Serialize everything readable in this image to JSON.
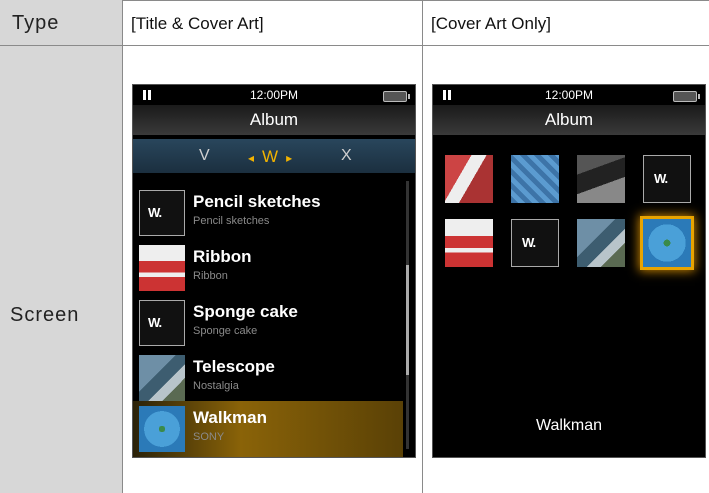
{
  "header": {
    "type_label": "Type",
    "col1": "[Title & Cover Art]",
    "col2": "[Cover Art Only]"
  },
  "row": {
    "label": "Screen"
  },
  "screen_title_cover": {
    "status": {
      "time": "12:00PM",
      "icons": [
        "pause-icon",
        "battery-icon"
      ]
    },
    "title": "Album",
    "letters": {
      "prev": "V",
      "current": "W",
      "next": "X"
    },
    "items": [
      {
        "title": "Pencil sketches",
        "subtitle": "Pencil sketches",
        "art": "walkman-logo"
      },
      {
        "title": "Ribbon",
        "subtitle": "Ribbon",
        "art": "ribbon-cover"
      },
      {
        "title": "Sponge cake",
        "subtitle": "Sponge cake",
        "art": "walkman-logo"
      },
      {
        "title": "Telescope",
        "subtitle": "Nostalgia",
        "art": "bird-cover"
      },
      {
        "title": "Walkman",
        "subtitle": "SONY",
        "art": "flower-cover",
        "selected": true
      }
    ]
  },
  "screen_cover_only": {
    "status": {
      "time": "12:00PM",
      "icons": [
        "pause-icon",
        "battery-icon"
      ]
    },
    "title": "Album",
    "tiles": [
      "guitar-cover",
      "keys-cover",
      "dark-cover",
      "walkman-logo",
      "ribbon-cover",
      "walkman-logo",
      "bird-cover",
      "flower-cover"
    ],
    "selected_tile": 7,
    "footer": "Walkman"
  },
  "colors": {
    "accent": "#f2b300",
    "header_bg": "#d7d7d7",
    "screen_bg": "#000000"
  }
}
